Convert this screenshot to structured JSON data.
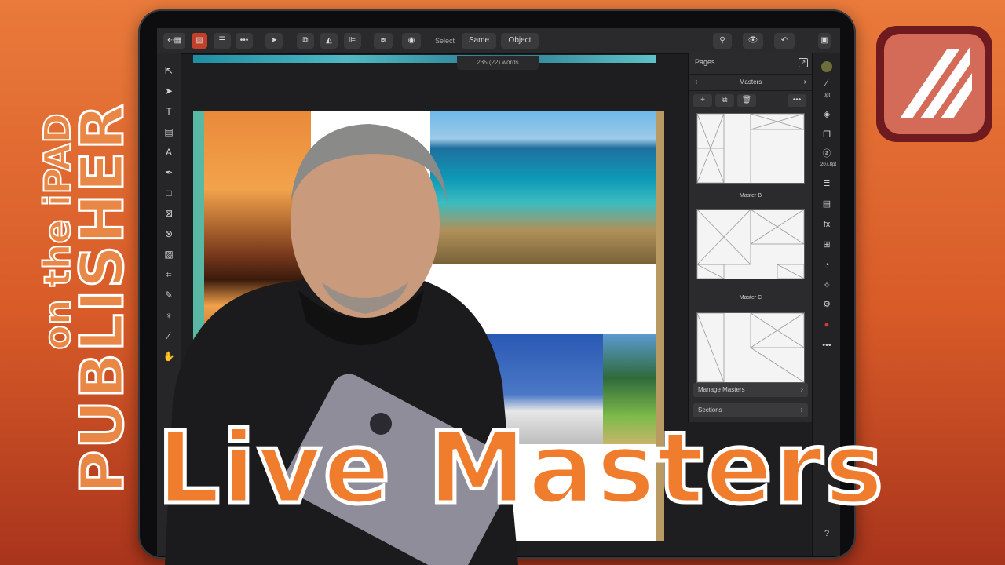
{
  "overlay": {
    "vertical_title": "PUBLISHER",
    "vertical_subtitle": "on the iPAD",
    "headline": "Live  Masters"
  },
  "toolbar": {
    "back_icon": "back-grid-icon",
    "select_label": "Select",
    "same_label": "Same",
    "object_label": "Object",
    "word_count": "235 (22) words"
  },
  "pages_panel": {
    "title": "Pages",
    "section_title": "Masters",
    "masters": [
      {
        "label": ""
      },
      {
        "label": "Master B"
      },
      {
        "label": "Master C"
      }
    ],
    "manage_masters": "Manage Masters",
    "sections": "Sections"
  },
  "right_strip": {
    "stroke_label": "0pt",
    "font_size_label": "207.8pt"
  },
  "colors": {
    "background_top": "#e97a3b",
    "headline": "#f07d2e",
    "ui_dark": "#1e1e20",
    "logo_bg": "#6f1a1e",
    "logo_fg": "#d46b59"
  }
}
